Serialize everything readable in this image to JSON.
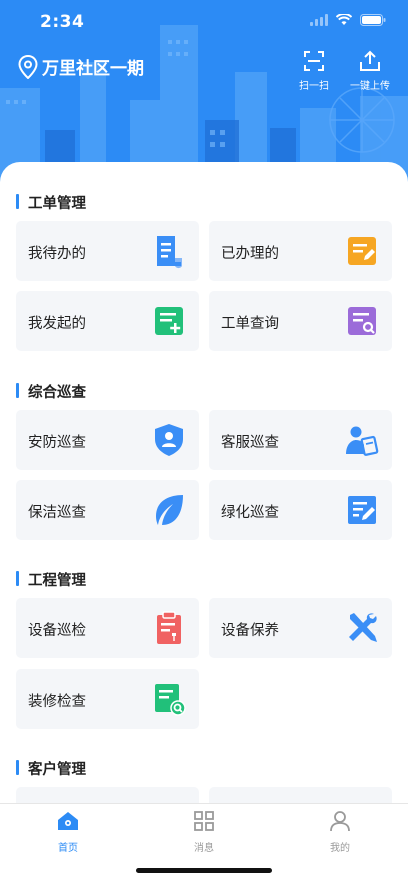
{
  "status_bar": {
    "time": "2:34"
  },
  "header": {
    "location": "万里社区一期",
    "scan_label": "扫一扫",
    "upload_label": "一键上传"
  },
  "colors": {
    "brand_blue": "#2c8bf5",
    "card_bg": "#f4f6f9"
  },
  "sections": [
    {
      "title": "工单管理",
      "items": [
        {
          "label": "我待办的",
          "icon": "document-icon",
          "color": "#3a8ef6"
        },
        {
          "label": "已办理的",
          "icon": "edit-document-icon",
          "color": "#f6a623"
        },
        {
          "label": "我发起的",
          "icon": "add-document-icon",
          "color": "#21c07a"
        },
        {
          "label": "工单查询",
          "icon": "search-document-icon",
          "color": "#9b6bd9"
        }
      ]
    },
    {
      "title": "综合巡查",
      "items": [
        {
          "label": "安防巡查",
          "icon": "security-shield-icon",
          "color": "#3a8ef6"
        },
        {
          "label": "客服巡查",
          "icon": "customer-service-icon",
          "color": "#3a8ef6"
        },
        {
          "label": "保洁巡查",
          "icon": "leaf-icon",
          "color": "#3a8ef6"
        },
        {
          "label": "绿化巡查",
          "icon": "edit-note-icon",
          "color": "#3a8ef6"
        }
      ]
    },
    {
      "title": "工程管理",
      "items": [
        {
          "label": "设备巡检",
          "icon": "clipboard-wrench-icon",
          "color": "#f06262"
        },
        {
          "label": "设备保养",
          "icon": "tools-icon",
          "color": "#3a8ef6"
        },
        {
          "label": "装修检查",
          "icon": "inspection-icon",
          "color": "#21c07a"
        }
      ]
    },
    {
      "title": "客户管理",
      "items": []
    }
  ],
  "tabbar": {
    "home": "首页",
    "messages": "消息",
    "mine": "我的"
  }
}
